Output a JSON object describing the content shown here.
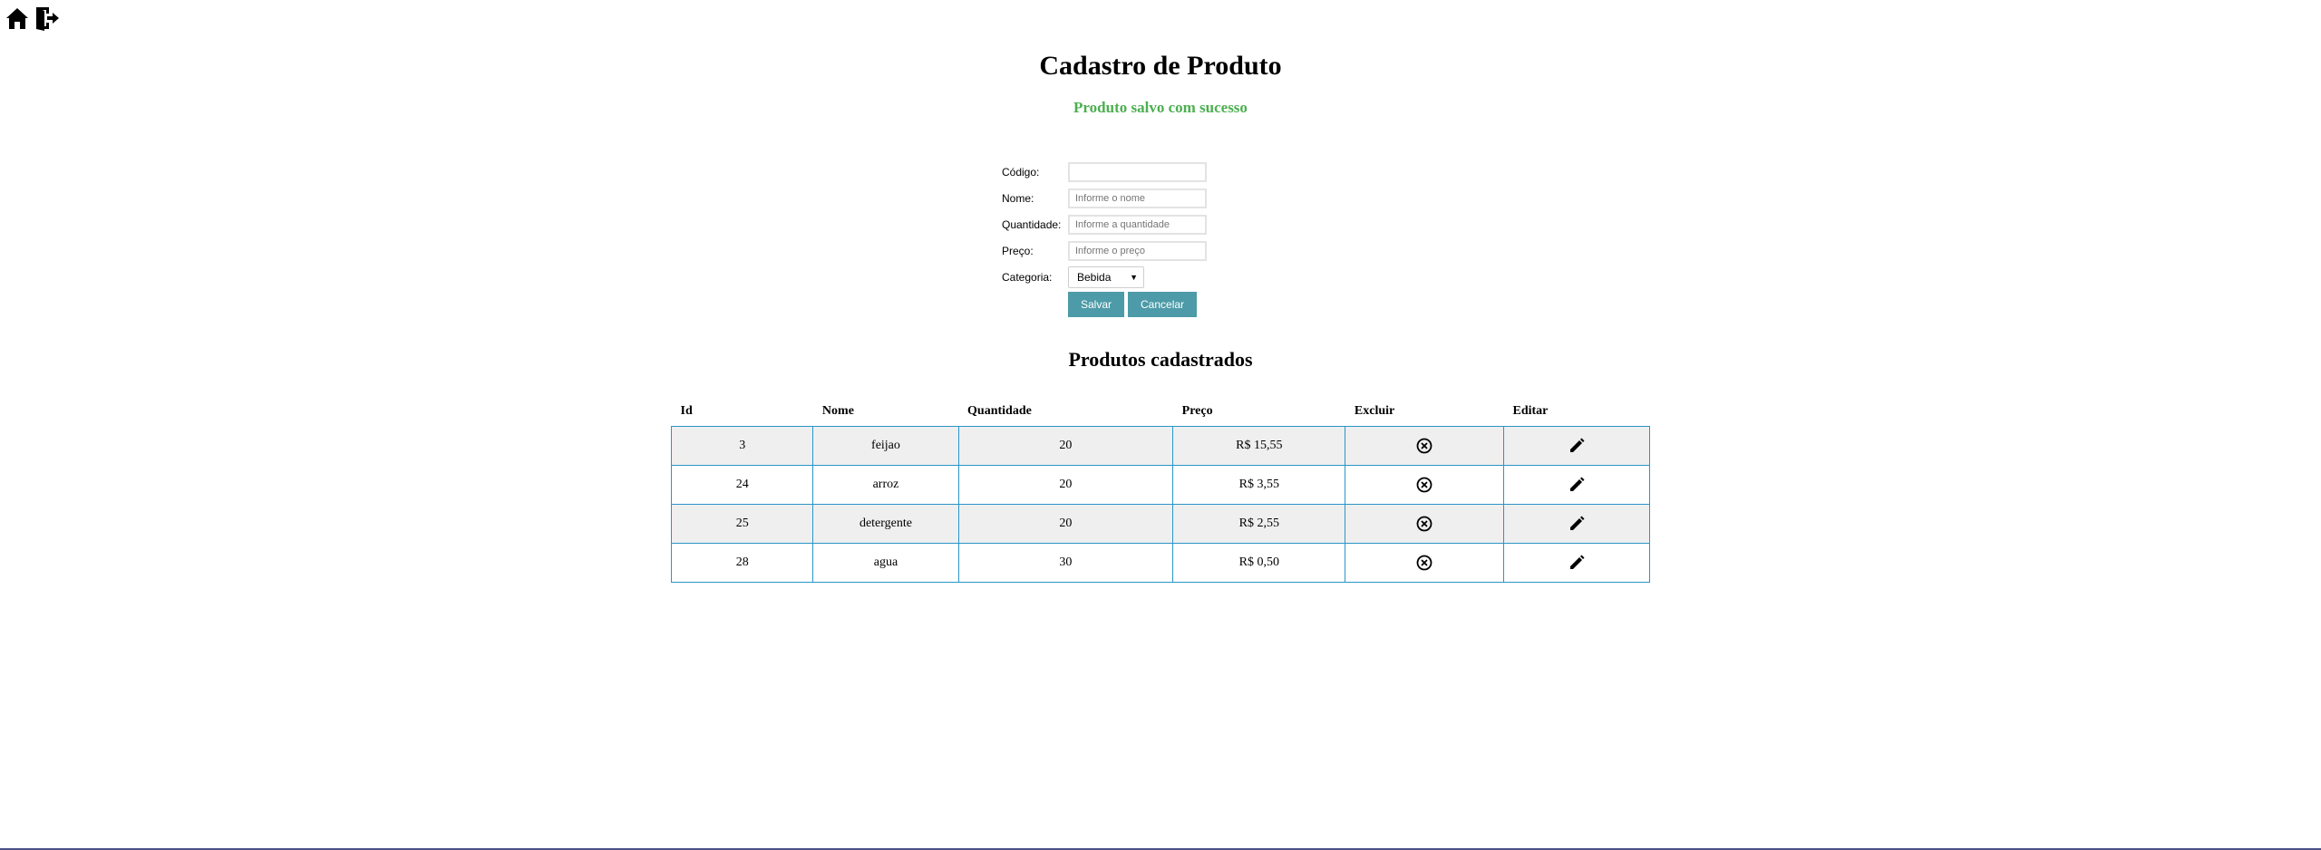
{
  "nav": {
    "home_icon": "home-icon",
    "logout_icon": "logout-icon"
  },
  "page": {
    "title": "Cadastro de Produto",
    "success_message": "Produto salvo com sucesso",
    "success_color": "#4caf50"
  },
  "form": {
    "codigo": {
      "label": "Código:",
      "value": "",
      "placeholder": ""
    },
    "nome": {
      "label": "Nome:",
      "value": "",
      "placeholder": "Informe o nome"
    },
    "quantidade": {
      "label": "Quantidade:",
      "value": "",
      "placeholder": "Informe a quantidade"
    },
    "preco": {
      "label": "Preço:",
      "value": "",
      "placeholder": "Informe o preço"
    },
    "categoria": {
      "label": "Categoria:",
      "selected": "Bebida"
    },
    "save_label": "Salvar",
    "cancel_label": "Cancelar",
    "button_color": "#4d9ba8"
  },
  "list": {
    "title": "Produtos cadastrados",
    "columns": [
      "Id",
      "Nome",
      "Quantidade",
      "Preço",
      "Excluir",
      "Editar"
    ],
    "rows": [
      {
        "id": "3",
        "nome": "feijao",
        "quantidade": "20",
        "preco": "R$ 15,55"
      },
      {
        "id": "24",
        "nome": "arroz",
        "quantidade": "20",
        "preco": "R$ 3,55"
      },
      {
        "id": "25",
        "nome": "detergente",
        "quantidade": "20",
        "preco": "R$ 2,55"
      },
      {
        "id": "28",
        "nome": "agua",
        "quantidade": "30",
        "preco": "R$ 0,50"
      }
    ],
    "delete_icon": "close-circle-icon",
    "edit_icon": "pencil-icon",
    "border_color": "#2a95c8"
  }
}
